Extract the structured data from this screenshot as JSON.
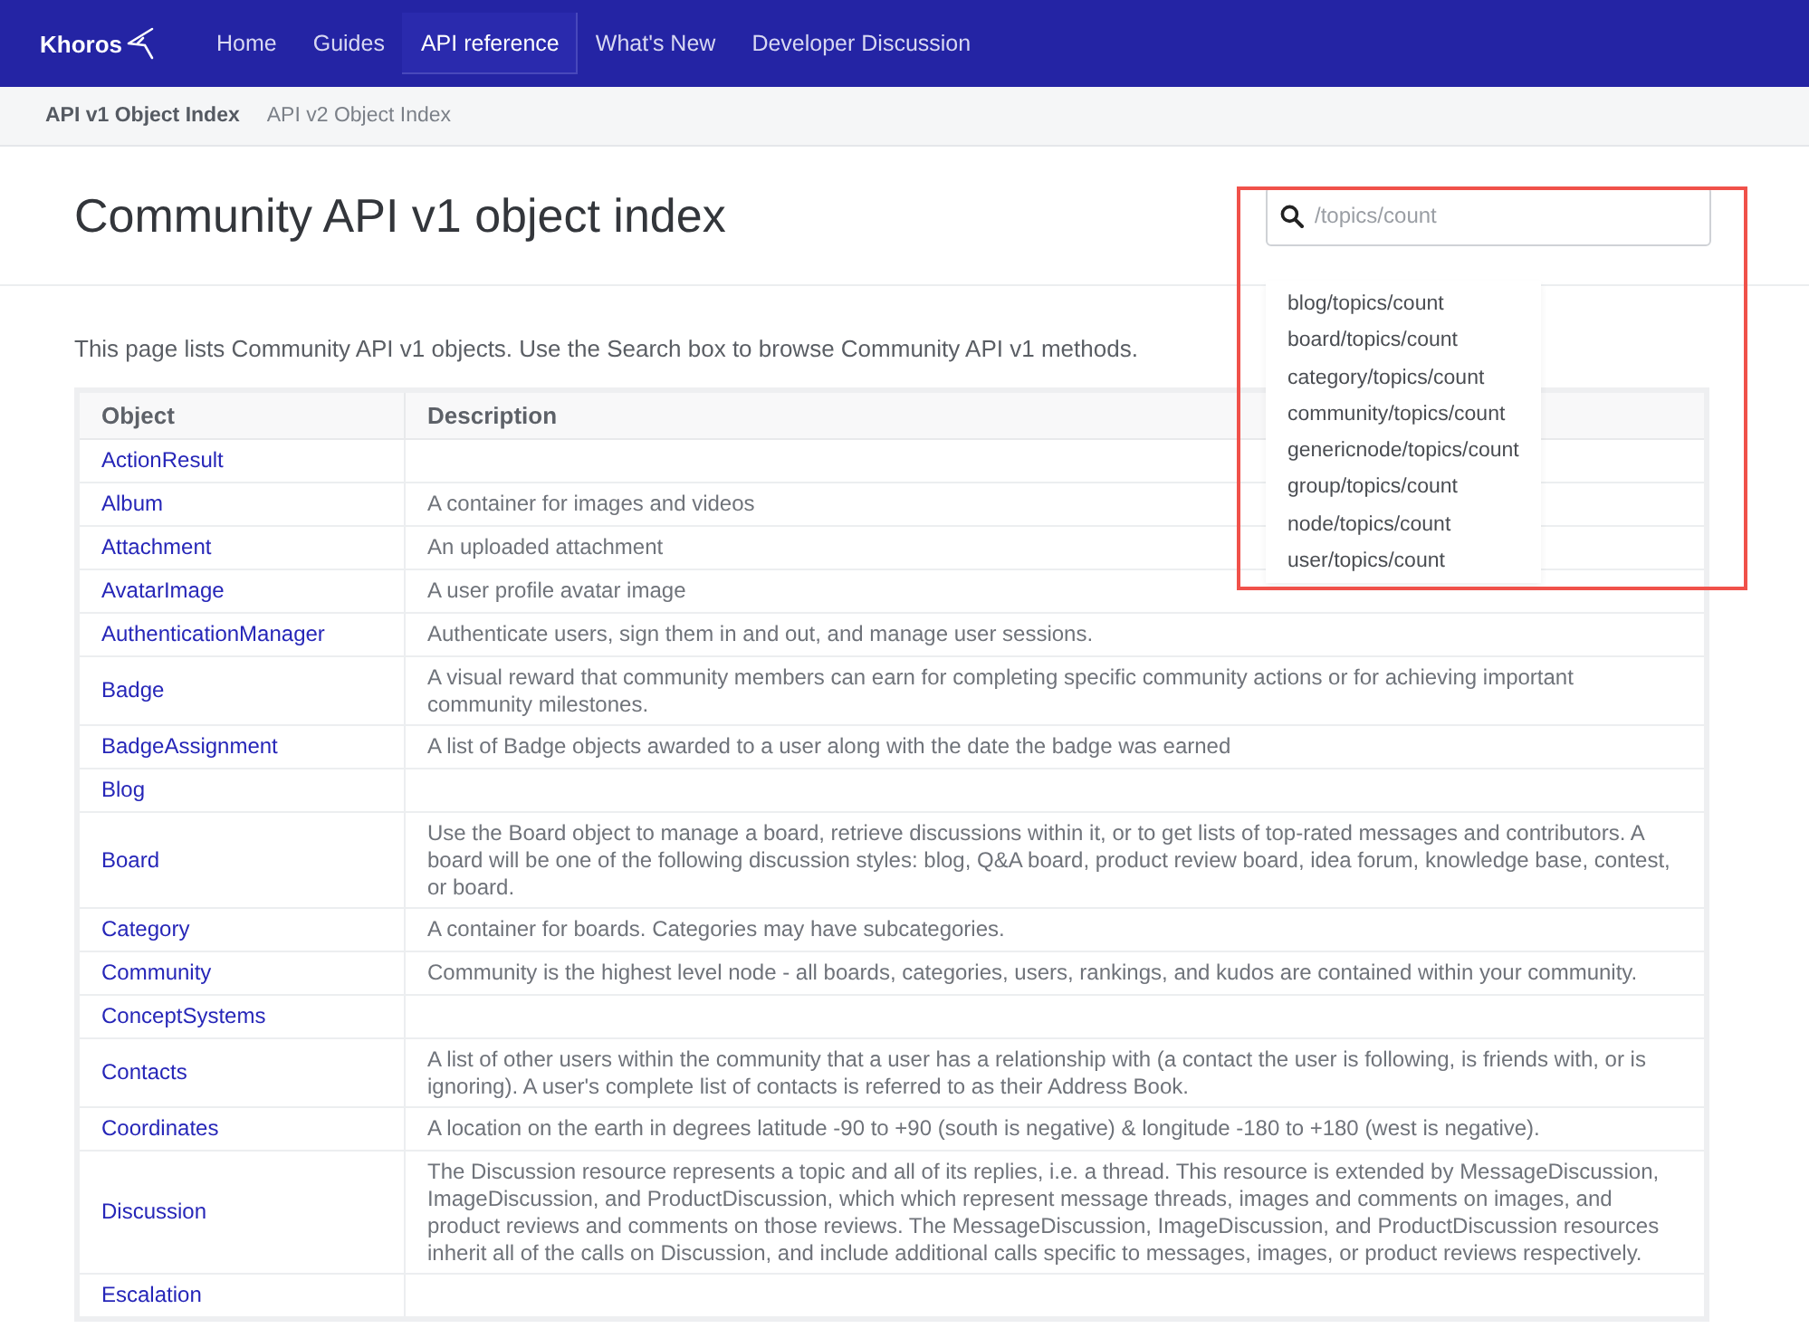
{
  "nav": {
    "logo": "Khoros",
    "items": [
      {
        "label": "Home",
        "selected": false
      },
      {
        "label": "Guides",
        "selected": false
      },
      {
        "label": "API reference",
        "selected": true
      },
      {
        "label": "What's New",
        "selected": false
      },
      {
        "label": "Developer Discussion",
        "selected": false
      }
    ]
  },
  "subnav": {
    "items": [
      {
        "label": "API v1 Object Index",
        "selected": true
      },
      {
        "label": "API v2 Object Index",
        "selected": false
      }
    ]
  },
  "title": "Community API v1 object index",
  "search": {
    "placeholder": "/topics/count",
    "suggestions": [
      "blog/topics/count",
      "board/topics/count",
      "category/topics/count",
      "community/topics/count",
      "genericnode/topics/count",
      "group/topics/count",
      "node/topics/count",
      "user/topics/count"
    ]
  },
  "intro": "This page lists Community API v1 objects. Use the Search box to browse Community API v1 methods.",
  "table": {
    "columns": [
      "Object",
      "Description"
    ],
    "rows": [
      {
        "object": "ActionResult",
        "description": ""
      },
      {
        "object": "Album",
        "description": "A container for images and videos"
      },
      {
        "object": "Attachment",
        "description": "An uploaded attachment"
      },
      {
        "object": "AvatarImage",
        "description": "A user profile avatar image"
      },
      {
        "object": "AuthenticationManager",
        "description": "Authenticate users, sign them in and out, and manage user sessions."
      },
      {
        "object": "Badge",
        "description": "A visual reward that community members can earn for completing specific community actions or for achieving important community milestones."
      },
      {
        "object": "BadgeAssignment",
        "description": "A list of Badge objects awarded to a user along with the date the badge was earned"
      },
      {
        "object": "Blog",
        "description": ""
      },
      {
        "object": "Board",
        "description": "Use the Board object to manage a board, retrieve discussions within it, or to get lists of top-rated messages and contributors. A board will be one of the following discussion styles: blog, Q&A board, product review board, idea forum, knowledge base, contest, or board."
      },
      {
        "object": "Category",
        "description": "A container for boards. Categories may have subcategories."
      },
      {
        "object": "Community",
        "description": "Community is the highest level node - all boards, categories, users, rankings, and kudos are contained within your community."
      },
      {
        "object": "ConceptSystems",
        "description": ""
      },
      {
        "object": "Contacts",
        "description": "A list of other users within the community that a user has a relationship with (a contact the user is following, is friends with, or is ignoring). A user's complete list of contacts is referred to as their Address Book."
      },
      {
        "object": "Coordinates",
        "description": "A location on the earth in degrees latitude -90 to +90 (south is negative) & longitude -180 to +180 (west is negative)."
      },
      {
        "object": "Discussion",
        "description": "The Discussion resource represents a topic and all of its replies, i.e. a thread. This resource is extended by MessageDiscussion, ImageDiscussion, and ProductDiscussion, which which represent message threads, images and comments on images, and product reviews and comments on those reviews. The MessageDiscussion, ImageDiscussion, and ProductDiscussion resources inherit all of the calls on Discussion, and include additional calls specific to messages, images, or product reviews respectively."
      },
      {
        "object": "Escalation",
        "description": ""
      }
    ]
  }
}
